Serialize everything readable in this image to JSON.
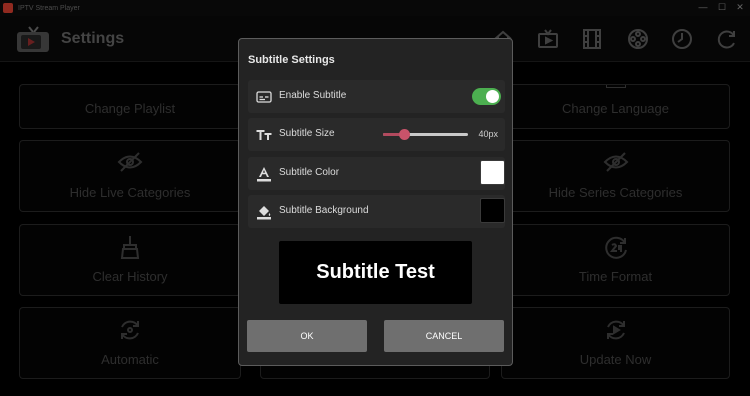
{
  "window": {
    "title": "IPTV Stream Player",
    "minimize_glyph": "—",
    "maximize_glyph": "☐",
    "close_glyph": "✕"
  },
  "header": {
    "title": "Settings",
    "icons": [
      "home-icon",
      "tv-icon",
      "film-icon",
      "series-icon",
      "history-icon",
      "refresh-icon"
    ]
  },
  "tiles": [
    {
      "label": "Change Playlist",
      "icon": "playlist-icon"
    },
    {
      "label": "Change Language",
      "icon": "language-icon"
    },
    {
      "label": "Hide Live Categories",
      "icon": "eye-off-icon"
    },
    {
      "label": "Hide Series Categories",
      "icon": "eye-off-icon"
    },
    {
      "label": "Clear History",
      "icon": "broom-icon"
    },
    {
      "label": "Time Format",
      "icon": "clock-24-icon"
    },
    {
      "label": "Automatic",
      "icon": "auto-icon"
    },
    {
      "label": "Update Now",
      "icon": "update-icon"
    }
  ],
  "dialog": {
    "title": "Subtitle Settings",
    "enable_label": "Enable Subtitle",
    "enable_on": true,
    "size_label": "Subtitle Size",
    "size_value": "40px",
    "size_fraction": 0.25,
    "color_label": "Subtitle Color",
    "color_value": "#ffffff",
    "background_label": "Subtitle Background",
    "background_value": "#000000",
    "preview_text": "Subtitle Test",
    "ok_label": "OK",
    "cancel_label": "CANCEL"
  },
  "colors": {
    "toggle_on": "#4caf50",
    "slider_accent": "#c8536a",
    "button": "#6f6f6f"
  }
}
